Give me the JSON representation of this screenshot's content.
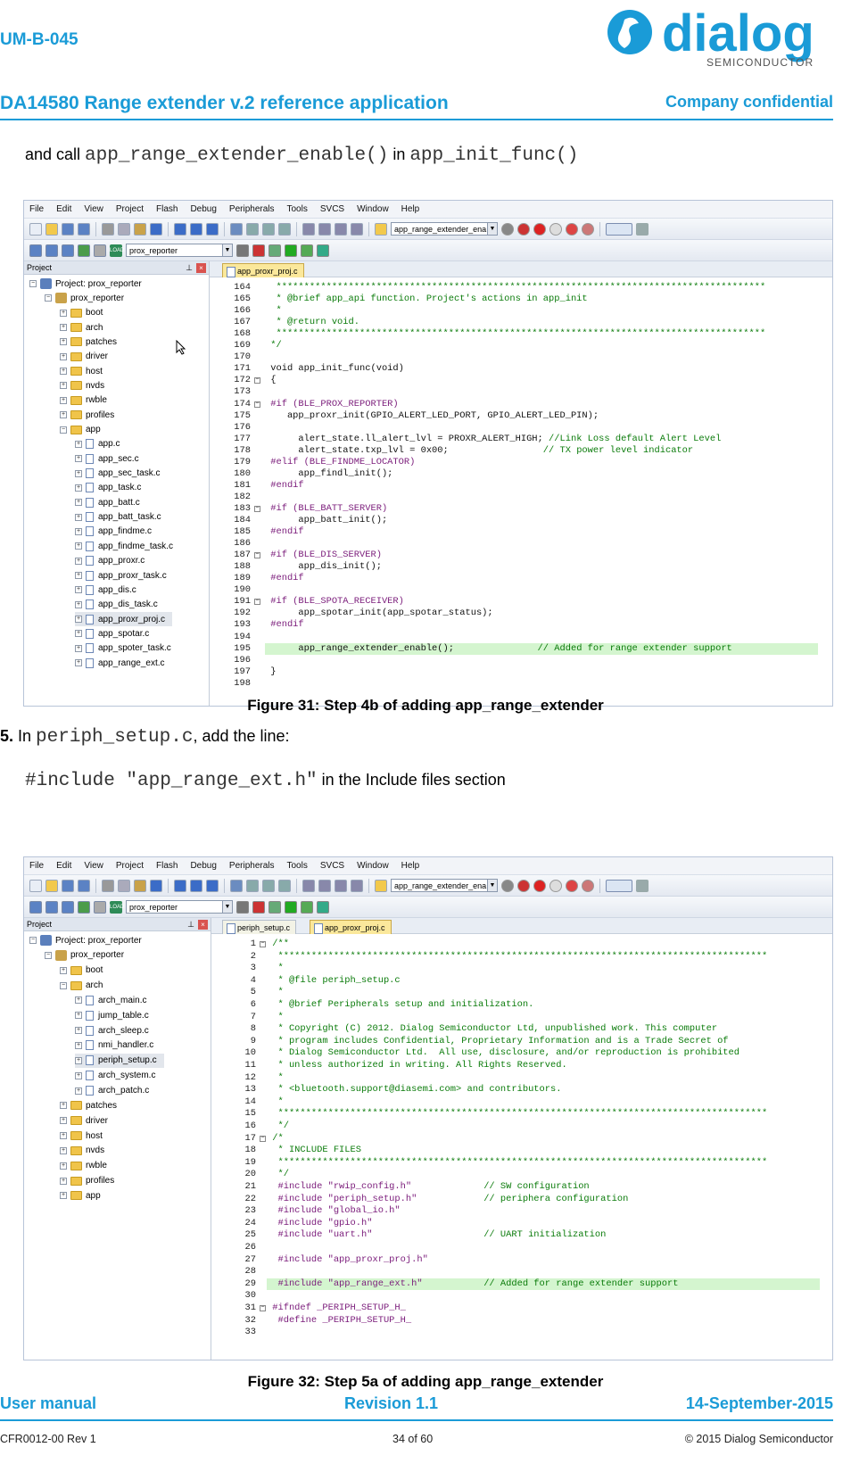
{
  "header": {
    "doc_id": "UM-B-045",
    "logo_text": "dialog",
    "logo_sub": "SEMICONDUCTOR",
    "title": "DA14580 Range extender v.2 reference application",
    "confidential": "Company confidential"
  },
  "para1": {
    "pre": "and call ",
    "fn1": "app_range_extender_enable()",
    "mid": " in ",
    "fn2": "app_init_func()"
  },
  "menu": [
    "File",
    "Edit",
    "View",
    "Project",
    "Flash",
    "Debug",
    "Peripherals",
    "Tools",
    "SVCS",
    "Window",
    "Help"
  ],
  "toolbar": {
    "target_combo": "app_range_extender_ena",
    "project_combo": "prox_reporter",
    "load_label": "LOAD"
  },
  "fig1": {
    "pane_title": "Project",
    "tab": "app_proxr_proj.c",
    "tree": [
      {
        "label": "Project: prox_reporter",
        "depth": 0,
        "kind": "project",
        "exp": "−"
      },
      {
        "label": "prox_reporter",
        "depth": 1,
        "kind": "target",
        "exp": "−"
      },
      {
        "label": "boot",
        "depth": 2,
        "kind": "folder",
        "exp": "+"
      },
      {
        "label": "arch",
        "depth": 2,
        "kind": "folder",
        "exp": "+"
      },
      {
        "label": "patches",
        "depth": 2,
        "kind": "folder",
        "exp": "+"
      },
      {
        "label": "driver",
        "depth": 2,
        "kind": "folder",
        "exp": "+"
      },
      {
        "label": "host",
        "depth": 2,
        "kind": "folder",
        "exp": "+"
      },
      {
        "label": "nvds",
        "depth": 2,
        "kind": "folder",
        "exp": "+"
      },
      {
        "label": "rwble",
        "depth": 2,
        "kind": "folder",
        "exp": "+"
      },
      {
        "label": "profiles",
        "depth": 2,
        "kind": "folder",
        "exp": "+"
      },
      {
        "label": "app",
        "depth": 2,
        "kind": "folder",
        "exp": "−"
      },
      {
        "label": "app.c",
        "depth": 3,
        "kind": "file",
        "exp": "+"
      },
      {
        "label": "app_sec.c",
        "depth": 3,
        "kind": "file",
        "exp": "+"
      },
      {
        "label": "app_sec_task.c",
        "depth": 3,
        "kind": "file",
        "exp": "+"
      },
      {
        "label": "app_task.c",
        "depth": 3,
        "kind": "file",
        "exp": "+"
      },
      {
        "label": "app_batt.c",
        "depth": 3,
        "kind": "file",
        "exp": "+"
      },
      {
        "label": "app_batt_task.c",
        "depth": 3,
        "kind": "file",
        "exp": "+"
      },
      {
        "label": "app_findme.c",
        "depth": 3,
        "kind": "file",
        "exp": "+"
      },
      {
        "label": "app_findme_task.c",
        "depth": 3,
        "kind": "file",
        "exp": "+"
      },
      {
        "label": "app_proxr.c",
        "depth": 3,
        "kind": "file",
        "exp": "+"
      },
      {
        "label": "app_proxr_task.c",
        "depth": 3,
        "kind": "file",
        "exp": "+"
      },
      {
        "label": "app_dis.c",
        "depth": 3,
        "kind": "file",
        "exp": "+"
      },
      {
        "label": "app_dis_task.c",
        "depth": 3,
        "kind": "file",
        "exp": "+"
      },
      {
        "label": "app_proxr_proj.c",
        "depth": 3,
        "kind": "file",
        "exp": "+",
        "selected": true
      },
      {
        "label": "app_spotar.c",
        "depth": 3,
        "kind": "file",
        "exp": "+"
      },
      {
        "label": "app_spoter_task.c",
        "depth": 3,
        "kind": "file",
        "exp": "+"
      },
      {
        "label": "app_range_ext.c",
        "depth": 3,
        "kind": "file",
        "exp": "+"
      }
    ],
    "code": [
      {
        "n": "164",
        "t": "  ****************************************************************************************",
        "c": "cm"
      },
      {
        "n": "165",
        "t": "  * @brief app_api function. Project's actions in app_init",
        "c": "cm"
      },
      {
        "n": "166",
        "t": "  *",
        "c": "cm"
      },
      {
        "n": "167",
        "t": "  * @return void.",
        "c": "cm"
      },
      {
        "n": "168",
        "t": "  ****************************************************************************************",
        "c": "cm"
      },
      {
        "n": "169",
        "t": " */",
        "c": "cm"
      },
      {
        "n": "170",
        "t": "",
        "c": ""
      },
      {
        "n": "171",
        "t": " void app_init_func(void)",
        "c": "",
        "kw": true
      },
      {
        "n": "172",
        "t": " {",
        "c": "",
        "fold": true
      },
      {
        "n": "173",
        "t": "",
        "c": ""
      },
      {
        "n": "174",
        "t": " #if (BLE_PROX_REPORTER)",
        "c": "",
        "pp": true,
        "fold": true
      },
      {
        "n": "175",
        "t": "    app_proxr_init(GPIO_ALERT_LED_PORT, GPIO_ALERT_LED_PIN);",
        "c": ""
      },
      {
        "n": "176",
        "t": "",
        "c": ""
      },
      {
        "n": "177",
        "t": "      alert_state.ll_alert_lvl = PROXR_ALERT_HIGH; //Link Loss default Alert Level",
        "c": "",
        "cmt": "//Link Loss default Alert Level"
      },
      {
        "n": "178",
        "t": "      alert_state.txp_lvl = 0x00;                 // TX power level indicator",
        "c": "",
        "cmt": "// TX power level indicator"
      },
      {
        "n": "179",
        "t": " #elif (BLE_FINDME_LOCATOR)",
        "c": "",
        "pp": true
      },
      {
        "n": "180",
        "t": "      app_findl_init();",
        "c": ""
      },
      {
        "n": "181",
        "t": " #endif",
        "c": "pp"
      },
      {
        "n": "182",
        "t": "",
        "c": ""
      },
      {
        "n": "183",
        "t": " #if (BLE_BATT_SERVER)",
        "c": "",
        "pp": true,
        "fold": true
      },
      {
        "n": "184",
        "t": "      app_batt_init();",
        "c": ""
      },
      {
        "n": "185",
        "t": " #endif",
        "c": "pp"
      },
      {
        "n": "186",
        "t": "",
        "c": ""
      },
      {
        "n": "187",
        "t": " #if (BLE_DIS_SERVER)",
        "c": "",
        "pp": true,
        "fold": true
      },
      {
        "n": "188",
        "t": "      app_dis_init();",
        "c": ""
      },
      {
        "n": "189",
        "t": " #endif",
        "c": "pp"
      },
      {
        "n": "190",
        "t": "",
        "c": ""
      },
      {
        "n": "191",
        "t": " #if (BLE_SPOTA_RECEIVER)",
        "c": "",
        "pp": true,
        "fold": true
      },
      {
        "n": "192",
        "t": "      app_spotar_init(app_spotar_status);",
        "c": ""
      },
      {
        "n": "193",
        "t": " #endif",
        "c": "pp"
      },
      {
        "n": "194",
        "t": "",
        "c": ""
      },
      {
        "n": "195",
        "t": "      app_range_extender_enable();               // Added for range extender support",
        "c": "",
        "cmt": "// Added for range extender support",
        "hl": true
      },
      {
        "n": "196",
        "t": "",
        "c": ""
      },
      {
        "n": "197",
        "t": " }",
        "c": ""
      },
      {
        "n": "198",
        "t": "",
        "c": ""
      }
    ],
    "caption": "Figure 31: Step 4b of adding app_range_extender"
  },
  "para2": {
    "num": "5.",
    "pre": " In ",
    "file": "periph_setup.c",
    "post": ", add the line:"
  },
  "para3": {
    "code": "#include \"app_range_ext.h\"",
    "post": " in the Include files section"
  },
  "fig2": {
    "pane_title": "Project",
    "tab_active": "periph_setup.c",
    "tab_inactive": "app_proxr_proj.c",
    "tree": [
      {
        "label": "Project: prox_reporter",
        "depth": 0,
        "kind": "project",
        "exp": "−"
      },
      {
        "label": "prox_reporter",
        "depth": 1,
        "kind": "target",
        "exp": "−"
      },
      {
        "label": "boot",
        "depth": 2,
        "kind": "folder",
        "exp": "+"
      },
      {
        "label": "arch",
        "depth": 2,
        "kind": "folder",
        "exp": "−"
      },
      {
        "label": "arch_main.c",
        "depth": 3,
        "kind": "file",
        "exp": "+"
      },
      {
        "label": "jump_table.c",
        "depth": 3,
        "kind": "file",
        "exp": "+"
      },
      {
        "label": "arch_sleep.c",
        "depth": 3,
        "kind": "file",
        "exp": "+"
      },
      {
        "label": "nmi_handler.c",
        "depth": 3,
        "kind": "file",
        "exp": "+"
      },
      {
        "label": "periph_setup.c",
        "depth": 3,
        "kind": "file",
        "exp": "+",
        "selected": true
      },
      {
        "label": "arch_system.c",
        "depth": 3,
        "kind": "file",
        "exp": "+"
      },
      {
        "label": "arch_patch.c",
        "depth": 3,
        "kind": "file",
        "exp": "+"
      },
      {
        "label": "patches",
        "depth": 2,
        "kind": "folder",
        "exp": "+"
      },
      {
        "label": "driver",
        "depth": 2,
        "kind": "folder",
        "exp": "+"
      },
      {
        "label": "host",
        "depth": 2,
        "kind": "folder",
        "exp": "+"
      },
      {
        "label": "nvds",
        "depth": 2,
        "kind": "folder",
        "exp": "+"
      },
      {
        "label": "rwble",
        "depth": 2,
        "kind": "folder",
        "exp": "+"
      },
      {
        "label": "profiles",
        "depth": 2,
        "kind": "folder",
        "exp": "+"
      },
      {
        "label": "app",
        "depth": 2,
        "kind": "folder",
        "exp": "+"
      }
    ],
    "code": [
      {
        "n": "1",
        "t": " /**",
        "c": "cm",
        "fold": true
      },
      {
        "n": "2",
        "t": "  ****************************************************************************************",
        "c": "cm"
      },
      {
        "n": "3",
        "t": "  *",
        "c": "cm"
      },
      {
        "n": "4",
        "t": "  * @file periph_setup.c",
        "c": "cm"
      },
      {
        "n": "5",
        "t": "  *",
        "c": "cm"
      },
      {
        "n": "6",
        "t": "  * @brief Peripherals setup and initialization.",
        "c": "cm"
      },
      {
        "n": "7",
        "t": "  *",
        "c": "cm"
      },
      {
        "n": "8",
        "t": "  * Copyright (C) 2012. Dialog Semiconductor Ltd, unpublished work. This computer",
        "c": "cm"
      },
      {
        "n": "9",
        "t": "  * program includes Confidential, Proprietary Information and is a Trade Secret of",
        "c": "cm"
      },
      {
        "n": "10",
        "t": "  * Dialog Semiconductor Ltd.  All use, disclosure, and/or reproduction is prohibited",
        "c": "cm"
      },
      {
        "n": "11",
        "t": "  * unless authorized in writing. All Rights Reserved.",
        "c": "cm"
      },
      {
        "n": "12",
        "t": "  *",
        "c": "cm"
      },
      {
        "n": "13",
        "t": "  * <bluetooth.support@diasemi.com> and contributors.",
        "c": "cm"
      },
      {
        "n": "14",
        "t": "  *",
        "c": "cm"
      },
      {
        "n": "15",
        "t": "  ****************************************************************************************",
        "c": "cm"
      },
      {
        "n": "16",
        "t": "  */",
        "c": "cm"
      },
      {
        "n": "17",
        "t": " /*",
        "c": "cm",
        "fold": true
      },
      {
        "n": "18",
        "t": "  * INCLUDE FILES",
        "c": "cm"
      },
      {
        "n": "19",
        "t": "  ****************************************************************************************",
        "c": "cm"
      },
      {
        "n": "20",
        "t": "  */",
        "c": "cm"
      },
      {
        "n": "21",
        "t": "  #include \"rwip_config.h\"             // SW configuration",
        "c": "",
        "inc": true,
        "cmt": "// SW configuration"
      },
      {
        "n": "22",
        "t": "  #include \"periph_setup.h\"            // periphera configuration",
        "c": "",
        "inc": true,
        "cmt": "// periphera configuration"
      },
      {
        "n": "23",
        "t": "  #include \"global_io.h\"",
        "c": "",
        "inc": true
      },
      {
        "n": "24",
        "t": "  #include \"gpio.h\"",
        "c": "",
        "inc": true
      },
      {
        "n": "25",
        "t": "  #include \"uart.h\"                    // UART initialization",
        "c": "",
        "inc": true,
        "cmt": "// UART initialization"
      },
      {
        "n": "26",
        "t": "",
        "c": ""
      },
      {
        "n": "27",
        "t": "  #include \"app_proxr_proj.h\"",
        "c": "",
        "inc": true
      },
      {
        "n": "28",
        "t": "",
        "c": ""
      },
      {
        "n": "29",
        "t": "  #include \"app_range_ext.h\"           // Added for range extender support",
        "c": "",
        "inc": true,
        "cmt": "// Added for range extender support",
        "hl": true
      },
      {
        "n": "30",
        "t": "",
        "c": ""
      },
      {
        "n": "31",
        "t": " #ifndef _PERIPH_SETUP_H_",
        "c": "",
        "pp": true,
        "fold": true
      },
      {
        "n": "32",
        "t": "  #define _PERIPH_SETUP_H_",
        "c": "",
        "pp": true
      },
      {
        "n": "33",
        "t": "",
        "c": ""
      }
    ],
    "caption": "Figure 32: Step 5a of adding app_range_extender"
  },
  "footer": {
    "left": "User manual",
    "center": "Revision 1.1",
    "right": "14-September-2015",
    "doc_rev": "CFR0012-00 Rev 1",
    "page": "34 of 60",
    "copyright": "© 2015 Dialog Semiconductor"
  },
  "colors": {
    "brand": "#1a9bd7",
    "comment": "#0a7b0a",
    "highlight": "#d4f5cf"
  }
}
